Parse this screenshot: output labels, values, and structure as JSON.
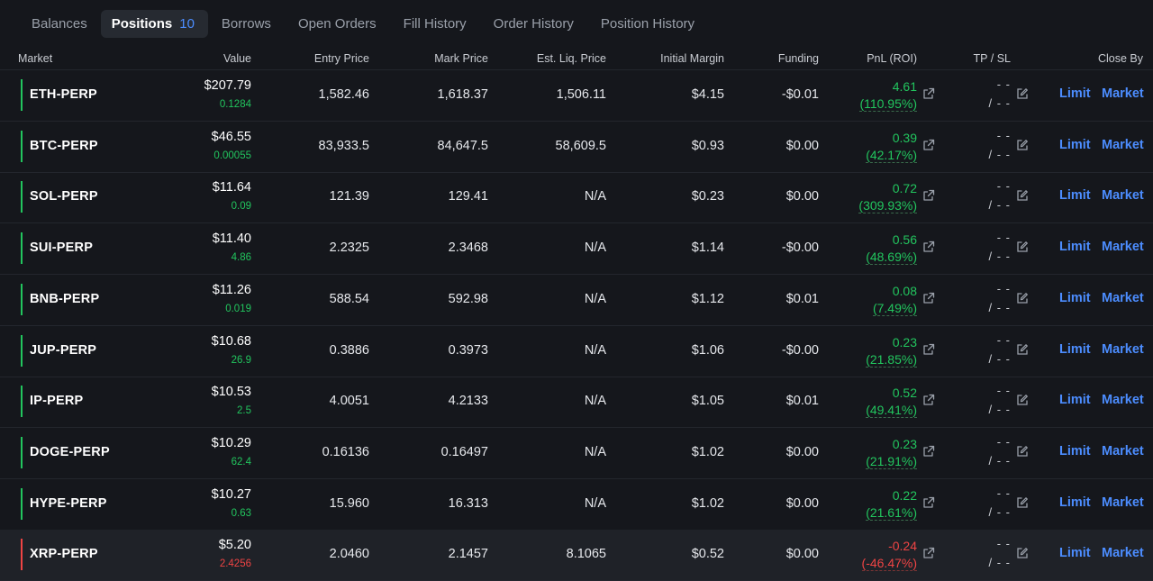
{
  "tabs": [
    {
      "label": "Balances"
    },
    {
      "label": "Positions",
      "count": "10",
      "active": true
    },
    {
      "label": "Borrows"
    },
    {
      "label": "Open Orders"
    },
    {
      "label": "Fill History"
    },
    {
      "label": "Order History"
    },
    {
      "label": "Position History"
    }
  ],
  "columns": {
    "market": "Market",
    "value": "Value",
    "entry": "Entry Price",
    "mark": "Mark Price",
    "liq": "Est. Liq. Price",
    "margin": "Initial Margin",
    "funding": "Funding",
    "pnl": "PnL (ROI)",
    "tpsl": "TP / SL",
    "close": "Close By"
  },
  "actions": {
    "limit": "Limit",
    "market": "Market",
    "tp_top": "- -",
    "tp_bottom": "/ - -"
  },
  "colors": {
    "positive": "#22c55e",
    "negative": "#ef4444",
    "accent": "#4c8dff"
  },
  "positions": [
    {
      "market": "ETH-PERP",
      "value": "$207.79",
      "size": "0.1284",
      "entry": "1,582.46",
      "mark": "1,618.37",
      "liq": "1,506.11",
      "margin": "$4.15",
      "funding": "-$0.01",
      "pnl": "4.61",
      "roi": "(110.95%)",
      "side": "long"
    },
    {
      "market": "BTC-PERP",
      "value": "$46.55",
      "size": "0.00055",
      "entry": "83,933.5",
      "mark": "84,647.5",
      "liq": "58,609.5",
      "margin": "$0.93",
      "funding": "$0.00",
      "pnl": "0.39",
      "roi": "(42.17%)",
      "side": "long"
    },
    {
      "market": "SOL-PERP",
      "value": "$11.64",
      "size": "0.09",
      "entry": "121.39",
      "mark": "129.41",
      "liq": "N/A",
      "margin": "$0.23",
      "funding": "$0.00",
      "pnl": "0.72",
      "roi": "(309.93%)",
      "side": "long"
    },
    {
      "market": "SUI-PERP",
      "value": "$11.40",
      "size": "4.86",
      "entry": "2.2325",
      "mark": "2.3468",
      "liq": "N/A",
      "margin": "$1.14",
      "funding": "-$0.00",
      "pnl": "0.56",
      "roi": "(48.69%)",
      "side": "long"
    },
    {
      "market": "BNB-PERP",
      "value": "$11.26",
      "size": "0.019",
      "entry": "588.54",
      "mark": "592.98",
      "liq": "N/A",
      "margin": "$1.12",
      "funding": "$0.01",
      "pnl": "0.08",
      "roi": "(7.49%)",
      "side": "long"
    },
    {
      "market": "JUP-PERP",
      "value": "$10.68",
      "size": "26.9",
      "entry": "0.3886",
      "mark": "0.3973",
      "liq": "N/A",
      "margin": "$1.06",
      "funding": "-$0.00",
      "pnl": "0.23",
      "roi": "(21.85%)",
      "side": "long"
    },
    {
      "market": "IP-PERP",
      "value": "$10.53",
      "size": "2.5",
      "entry": "4.0051",
      "mark": "4.2133",
      "liq": "N/A",
      "margin": "$1.05",
      "funding": "$0.01",
      "pnl": "0.52",
      "roi": "(49.41%)",
      "side": "long"
    },
    {
      "market": "DOGE-PERP",
      "value": "$10.29",
      "size": "62.4",
      "entry": "0.16136",
      "mark": "0.16497",
      "liq": "N/A",
      "margin": "$1.02",
      "funding": "$0.00",
      "pnl": "0.23",
      "roi": "(21.91%)",
      "side": "long"
    },
    {
      "market": "HYPE-PERP",
      "value": "$10.27",
      "size": "0.63",
      "entry": "15.960",
      "mark": "16.313",
      "liq": "N/A",
      "margin": "$1.02",
      "funding": "$0.00",
      "pnl": "0.22",
      "roi": "(21.61%)",
      "side": "long"
    },
    {
      "market": "XRP-PERP",
      "value": "$5.20",
      "size": "2.4256",
      "entry": "2.0460",
      "mark": "2.1457",
      "liq": "8.1065",
      "margin": "$0.52",
      "funding": "$0.00",
      "pnl": "-0.24",
      "roi": "(-46.47%)",
      "side": "short",
      "highlighted": true
    }
  ]
}
